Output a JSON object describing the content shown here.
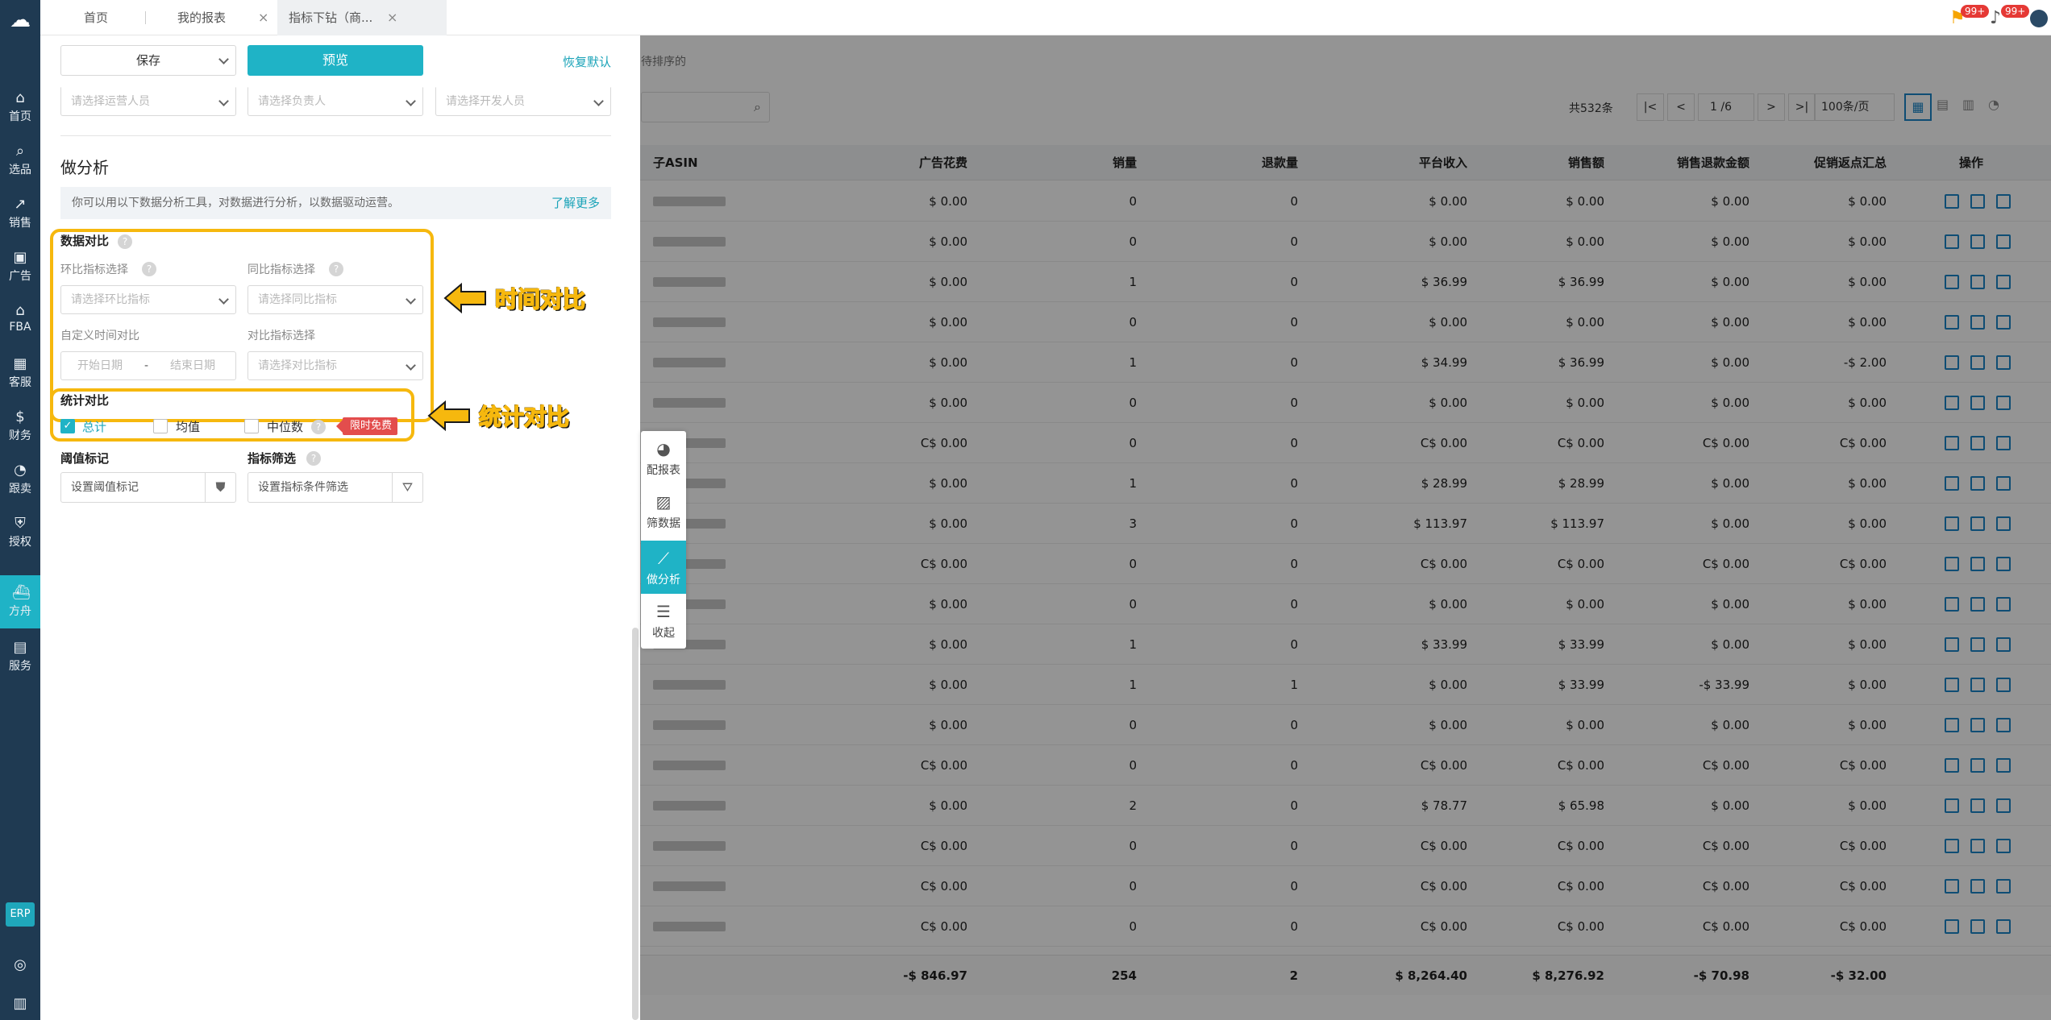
{
  "tabs": [
    {
      "label": "首页"
    },
    {
      "label": "我的报表"
    },
    {
      "label": "指标下钻（商..."
    }
  ],
  "badges": {
    "flag_count": "99+",
    "bell_count": "99+"
  },
  "rail": {
    "items": [
      {
        "label": "首页"
      },
      {
        "label": "选品"
      },
      {
        "label": "销售"
      },
      {
        "label": "广告"
      },
      {
        "label": "FBA"
      },
      {
        "label": "客服"
      },
      {
        "label": "财务"
      },
      {
        "label": "跟卖"
      },
      {
        "label": "授权"
      },
      {
        "label": "方舟"
      },
      {
        "label": "服务"
      }
    ],
    "erp": "ERP"
  },
  "panel": {
    "save_label": "保存",
    "preview_label": "预览",
    "reset_label": "恢复默认",
    "operators_placeholder": "请选择运营人员",
    "owner_placeholder": "请选择负责人",
    "developer_placeholder": "请选择开发人员",
    "analysis_title": "做分析",
    "tip_text": "你可以用以下数据分析工具，对数据进行分析，以数据驱动运营。",
    "learn_more": "了解更多",
    "data_compare": {
      "title": "数据对比",
      "mom_label": "环比指标选择",
      "mom_placeholder": "请选择环比指标",
      "yoy_label": "同比指标选择",
      "yoy_placeholder": "请选择同比指标",
      "custom_label": "自定义时间对比",
      "start_placeholder": "开始日期",
      "range_sep": "-",
      "end_placeholder": "结束日期",
      "compare_label": "对比指标选择",
      "compare_placeholder": "请选择对比指标"
    },
    "stats_compare": {
      "title": "统计对比",
      "total": "总计",
      "total_checked": true,
      "mean": "均值",
      "median": "中位数",
      "free_tag": "限时免费"
    },
    "threshold": {
      "label": "阈值标记",
      "placeholder": "设置阈值标记"
    },
    "filter": {
      "label": "指标筛选",
      "placeholder": "设置指标条件筛选"
    }
  },
  "annotations": {
    "time_compare": "时间对比",
    "stats_compare": "统计对比"
  },
  "floating_toolbar": [
    {
      "label": "配报表"
    },
    {
      "label": "筛数据"
    },
    {
      "label": "做分析"
    },
    {
      "label": "收起"
    }
  ],
  "background_table": {
    "sort_hint": "待排序的",
    "total_label": "共532条",
    "page_current": "1",
    "page_total": "/6",
    "page_size": "100条/页",
    "columns": [
      "子ASIN",
      "广告花费",
      "销量",
      "退款量",
      "平台收入",
      "销售额",
      "销售退款金额",
      "促销返点汇总",
      "操作"
    ],
    "rows": [
      [
        "$ 0.00",
        "0",
        "0",
        "$ 0.00",
        "$ 0.00",
        "$ 0.00",
        "$ 0.00"
      ],
      [
        "$ 0.00",
        "0",
        "0",
        "$ 0.00",
        "$ 0.00",
        "$ 0.00",
        "$ 0.00"
      ],
      [
        "$ 0.00",
        "1",
        "0",
        "$ 36.99",
        "$ 36.99",
        "$ 0.00",
        "$ 0.00"
      ],
      [
        "$ 0.00",
        "0",
        "0",
        "$ 0.00",
        "$ 0.00",
        "$ 0.00",
        "$ 0.00"
      ],
      [
        "$ 0.00",
        "1",
        "0",
        "$ 34.99",
        "$ 36.99",
        "$ 0.00",
        "-$ 2.00"
      ],
      [
        "$ 0.00",
        "0",
        "0",
        "$ 0.00",
        "$ 0.00",
        "$ 0.00",
        "$ 0.00"
      ],
      [
        "C$ 0.00",
        "0",
        "0",
        "C$ 0.00",
        "C$ 0.00",
        "C$ 0.00",
        "C$ 0.00"
      ],
      [
        "$ 0.00",
        "1",
        "0",
        "$ 28.99",
        "$ 28.99",
        "$ 0.00",
        "$ 0.00"
      ],
      [
        "$ 0.00",
        "3",
        "0",
        "$ 113.97",
        "$ 113.97",
        "$ 0.00",
        "$ 0.00"
      ],
      [
        "C$ 0.00",
        "0",
        "0",
        "C$ 0.00",
        "C$ 0.00",
        "C$ 0.00",
        "C$ 0.00"
      ],
      [
        "$ 0.00",
        "0",
        "0",
        "$ 0.00",
        "$ 0.00",
        "$ 0.00",
        "$ 0.00"
      ],
      [
        "$ 0.00",
        "1",
        "0",
        "$ 33.99",
        "$ 33.99",
        "$ 0.00",
        "$ 0.00"
      ],
      [
        "$ 0.00",
        "1",
        "1",
        "$ 0.00",
        "$ 33.99",
        "-$ 33.99",
        "$ 0.00"
      ],
      [
        "$ 0.00",
        "0",
        "0",
        "$ 0.00",
        "$ 0.00",
        "$ 0.00",
        "$ 0.00"
      ],
      [
        "C$ 0.00",
        "0",
        "0",
        "C$ 0.00",
        "C$ 0.00",
        "C$ 0.00",
        "C$ 0.00"
      ],
      [
        "$ 0.00",
        "2",
        "0",
        "$ 78.77",
        "$ 65.98",
        "$ 0.00",
        "$ 0.00"
      ],
      [
        "C$ 0.00",
        "0",
        "0",
        "C$ 0.00",
        "C$ 0.00",
        "C$ 0.00",
        "C$ 0.00"
      ],
      [
        "C$ 0.00",
        "0",
        "0",
        "C$ 0.00",
        "C$ 0.00",
        "C$ 0.00",
        "C$ 0.00"
      ],
      [
        "C$ 0.00",
        "0",
        "0",
        "C$ 0.00",
        "C$ 0.00",
        "C$ 0.00",
        "C$ 0.00"
      ]
    ],
    "totals": [
      "-$ 846.97",
      "254",
      "2",
      "$ 8,264.40",
      "$ 8,276.92",
      "-$ 70.98",
      "-$ 32.00"
    ]
  }
}
